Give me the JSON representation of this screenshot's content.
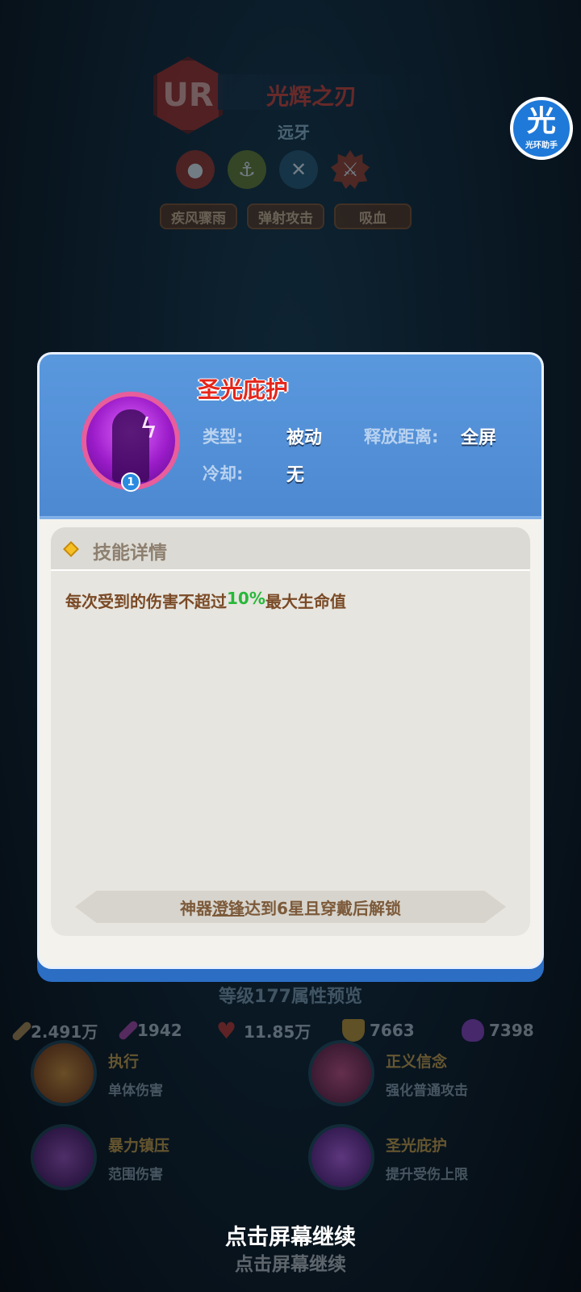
{
  "background": {
    "rarity": "UR",
    "hero_name": "光辉之刃",
    "hero_tag": "远牙",
    "traits": [
      "疾风骤雨",
      "弹射攻击",
      "吸血"
    ],
    "level_title": "等级177属性预览",
    "stats": [
      {
        "icon": "sword-icon",
        "value": "2.491万",
        "color": "#c49a5a"
      },
      {
        "icon": "wand-icon",
        "value": "1942",
        "color": "#c04ab8"
      },
      {
        "icon": "heart-icon",
        "value": "11.85万",
        "color": "#d6342a"
      },
      {
        "icon": "shield-icon",
        "value": "7663",
        "color": "#d9a12b"
      },
      {
        "icon": "potion-icon",
        "value": "7398",
        "color": "#9b44d6"
      }
    ],
    "skills": [
      {
        "name": "执行",
        "desc": "单体伤害",
        "color": "#e07a1a"
      },
      {
        "name": "正义信念",
        "desc": "强化普通攻击",
        "color": "#b52a66"
      },
      {
        "name": "暴力镇压",
        "desc": "范围伤害",
        "color": "#8a2fb8"
      },
      {
        "name": "圣光庇护",
        "desc": "提升受伤上限",
        "color": "#9b2fd1"
      }
    ]
  },
  "helper": {
    "glyph": "光",
    "label": "光环助手"
  },
  "dialog": {
    "skill_name": "圣光庇护",
    "level": "1",
    "type_label": "类型:",
    "type_value": "被动",
    "range_label": "释放距离:",
    "range_value": "全屏",
    "cooldown_label": "冷却:",
    "cooldown_value": "无",
    "detail_title": "技能详情",
    "desc_before": "每次受到的伤害不超过",
    "desc_highlight": "10%",
    "desc_after": "最大生命值",
    "unlock_pre": "神器",
    "unlock_under": "澄锋",
    "unlock_post": "达到6星且穿戴后解锁"
  },
  "prompt": "点击屏幕继续"
}
